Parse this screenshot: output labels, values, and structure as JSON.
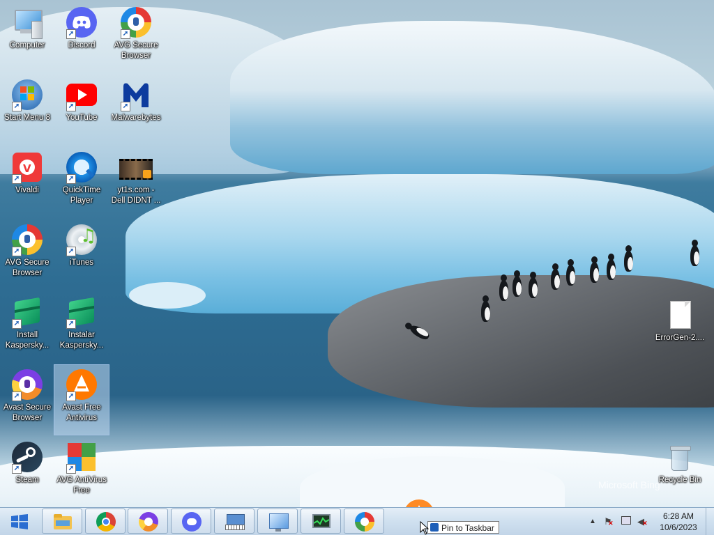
{
  "desktop": {
    "watermark": "Microsoft Bing",
    "icons": [
      {
        "label": "Computer",
        "icon": "computer-icon"
      },
      {
        "label": "Discord",
        "icon": "discord-icon"
      },
      {
        "label": "AVG Secure Browser",
        "icon": "avg-secure-browser-icon"
      },
      {
        "label": "Start Menu 8",
        "icon": "start-menu-8-icon"
      },
      {
        "label": "YouTube",
        "icon": "youtube-icon"
      },
      {
        "label": "Malwarebytes",
        "icon": "malwarebytes-icon"
      },
      {
        "label": "Vivaldi",
        "icon": "vivaldi-icon"
      },
      {
        "label": "QuickTime Player",
        "icon": "quicktime-icon"
      },
      {
        "label": "yt1s.com - Dell DIDNT ...",
        "icon": "video-file-icon"
      },
      {
        "label": "AVG Secure Browser",
        "icon": "avg-secure-browser-icon"
      },
      {
        "label": "iTunes",
        "icon": "itunes-icon"
      },
      {
        "label": "Install Kaspersky...",
        "icon": "kaspersky-icon"
      },
      {
        "label": "Instalar Kaspersky...",
        "icon": "kaspersky-icon"
      },
      {
        "label": "Avast Secure Browser",
        "icon": "avast-secure-browser-icon"
      },
      {
        "label": "Avast Free Antivirus",
        "icon": "avast-antivirus-icon"
      },
      {
        "label": "Steam",
        "icon": "steam-icon"
      },
      {
        "label": "AVG AntiVirus Free",
        "icon": "avg-antivirus-icon"
      },
      {
        "label": "ErrorGen-2....",
        "icon": "blank-file-icon"
      },
      {
        "label": "Recycle Bin",
        "icon": "recycle-bin-icon"
      }
    ]
  },
  "taskbar": {
    "start_icon": "windows-logo-icon",
    "pinned": [
      {
        "icon": "file-explorer-icon"
      },
      {
        "icon": "chrome-icon"
      },
      {
        "icon": "avg-browser-icon"
      },
      {
        "icon": "discord-icon"
      },
      {
        "icon": "on-screen-keyboard-icon"
      },
      {
        "icon": "control-panel-icon"
      },
      {
        "icon": "task-manager-icon"
      },
      {
        "icon": "avg-secure-browser-icon"
      }
    ],
    "tooltip": "Pin to Taskbar",
    "clock": {
      "time": "6:28 AM",
      "date": "10/6/2023"
    }
  }
}
